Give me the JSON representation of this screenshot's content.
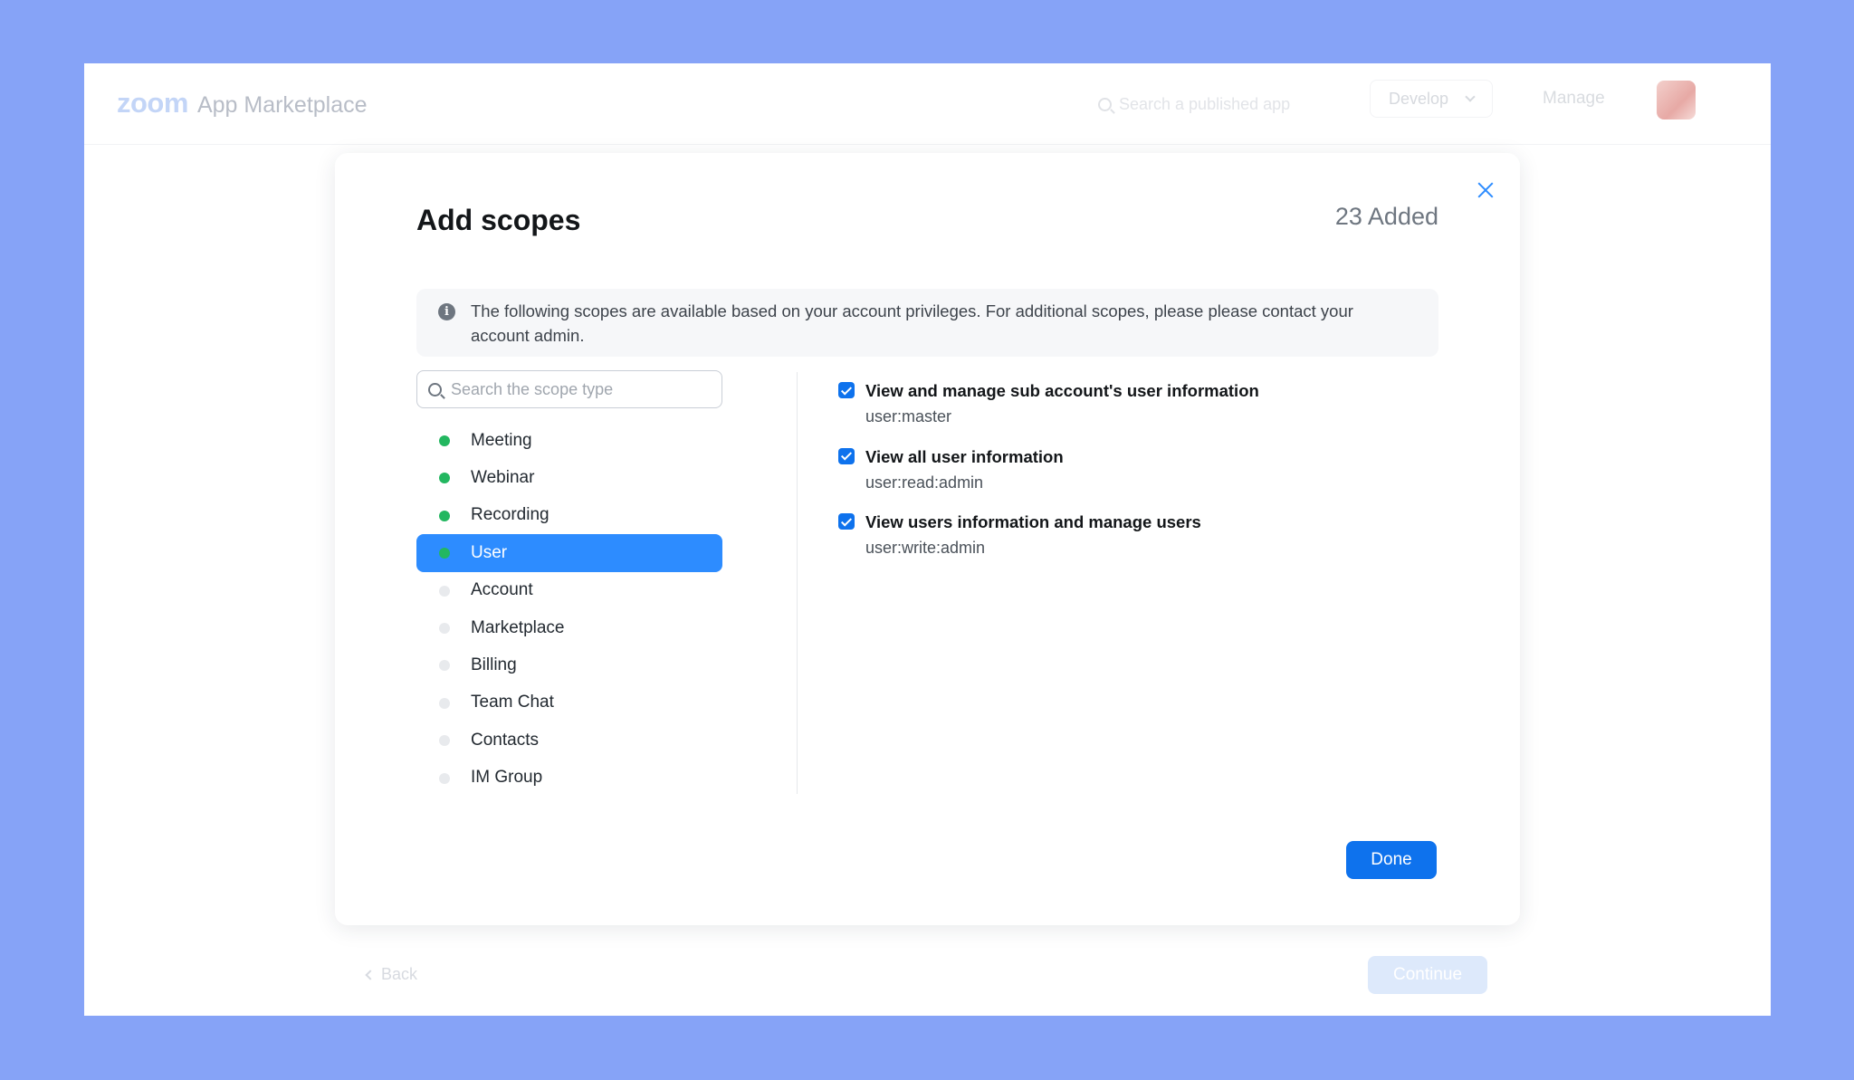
{
  "header": {
    "logo": "zoom",
    "brand_name": "App Marketplace",
    "search_placeholder": "Search a published app",
    "develop_label": "Develop",
    "manage_label": "Manage"
  },
  "footer": {
    "back_label": "Back",
    "continue_label": "Continue"
  },
  "modal": {
    "title": "Add scopes",
    "added_count": "23 Added",
    "info_text": "The following scopes are available based on your account privileges. For additional scopes, please please contact your account admin.",
    "search_placeholder": "Search the scope type",
    "categories": [
      {
        "label": "Meeting",
        "has_scopes": true,
        "selected": false
      },
      {
        "label": "Webinar",
        "has_scopes": true,
        "selected": false
      },
      {
        "label": "Recording",
        "has_scopes": true,
        "selected": false
      },
      {
        "label": "User",
        "has_scopes": true,
        "selected": true
      },
      {
        "label": "Account",
        "has_scopes": false,
        "selected": false
      },
      {
        "label": "Marketplace",
        "has_scopes": false,
        "selected": false
      },
      {
        "label": "Billing",
        "has_scopes": false,
        "selected": false
      },
      {
        "label": "Team Chat",
        "has_scopes": false,
        "selected": false
      },
      {
        "label": "Contacts",
        "has_scopes": false,
        "selected": false
      },
      {
        "label": "IM Group",
        "has_scopes": false,
        "selected": false
      }
    ],
    "scopes": [
      {
        "title": "View and manage sub account's user information",
        "code": "user:master",
        "checked": true
      },
      {
        "title": "View all user information",
        "code": "user:read:admin",
        "checked": true
      },
      {
        "title": "View users information and manage users",
        "code": "user:write:admin",
        "checked": true
      }
    ],
    "done_label": "Done"
  },
  "colors": {
    "background": "#86a3f7",
    "accent": "#0e72ed",
    "selected": "#2d8cff",
    "active_dot": "#23b760"
  }
}
